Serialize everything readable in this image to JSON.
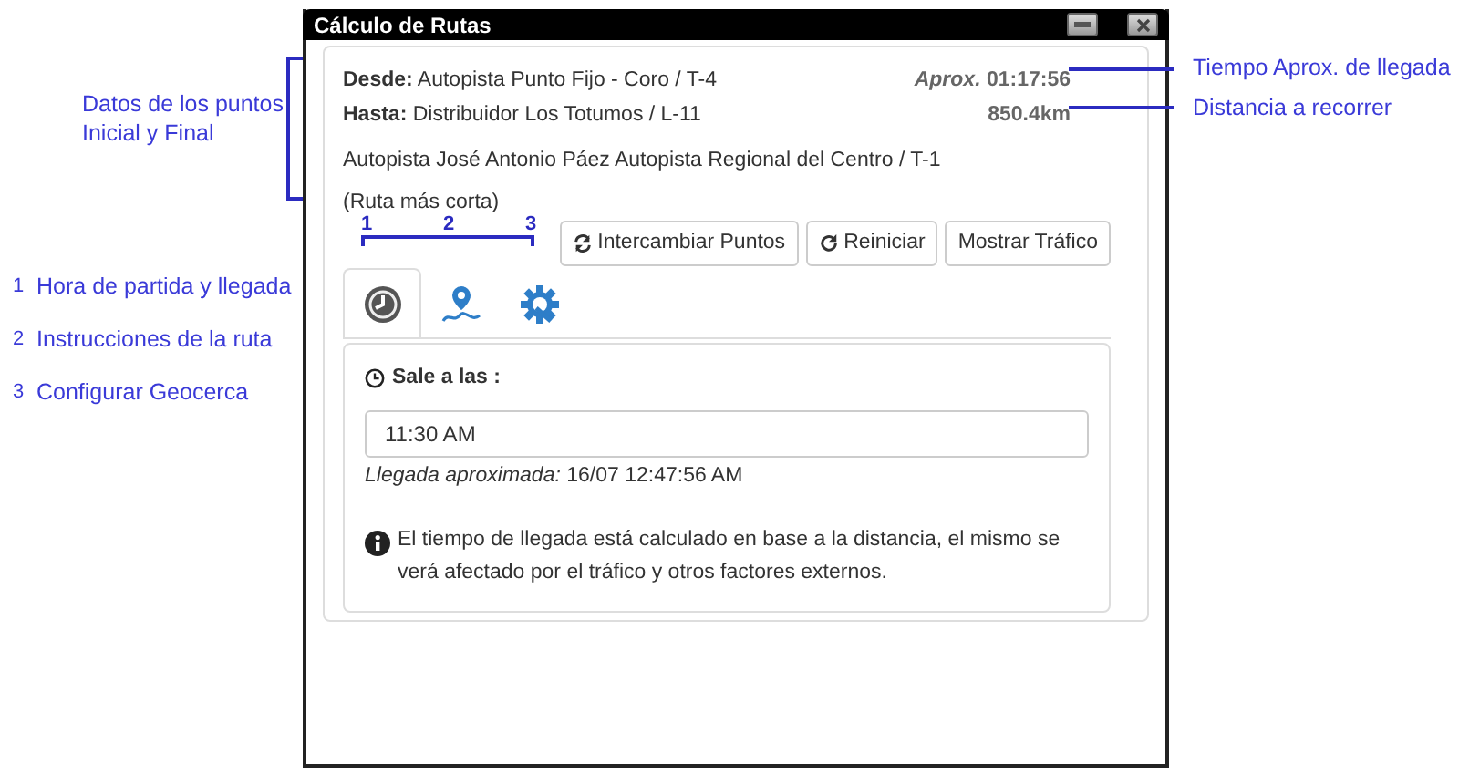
{
  "window": {
    "title": "Cálculo de Rutas"
  },
  "route": {
    "from": "**Desde:** Autopista Punto Fijo - Coro / T-4",
    "to": "**Hasta:** Distribuidor Los Totumos / L-11",
    "eta": "*Aprox.* 01:17:56",
    "distance": "850.4km",
    "road": "Autopista José Antonio Páez Autopista Regional del Centro / T-1",
    "note": "(Ruta más corta)"
  },
  "buttons": [
    {
      "label": "Intercambiar Puntos",
      "kind": "swap"
    },
    {
      "label": "Reiniciar",
      "kind": "reload"
    },
    {
      "label": "Mostrar Tráfico",
      "kind": "plain"
    }
  ],
  "tabs": [
    {
      "kind": "clock",
      "selected": true
    },
    {
      "kind": "route",
      "selected": false
    },
    {
      "kind": "gear",
      "selected": false
    }
  ],
  "panel": {
    "label": "Sale a las :",
    "time": "11:30 AM",
    "arrival": "*Llegada aproximada:* 16/07 12:47:56 AM",
    "info": "El tiempo de llegada está calculado en base a la distancia, el mismo se verá afectado por el tráfico y otros factores externos."
  },
  "annotations": {
    "points": [
      "Datos de los puntos",
      "Inicial y Final"
    ],
    "tab_numbers": [
      "1",
      "2",
      "3"
    ],
    "legend": [
      {
        "number": "1",
        "text": "Hora de partida y llegada"
      },
      {
        "number": "2",
        "text": "Instrucciones de la ruta"
      },
      {
        "number": "3",
        "text": "Configurar Geocerca"
      }
    ],
    "right": [
      "Tiempo Aprox. de llegada",
      "Distancia a recorrer"
    ]
  }
}
